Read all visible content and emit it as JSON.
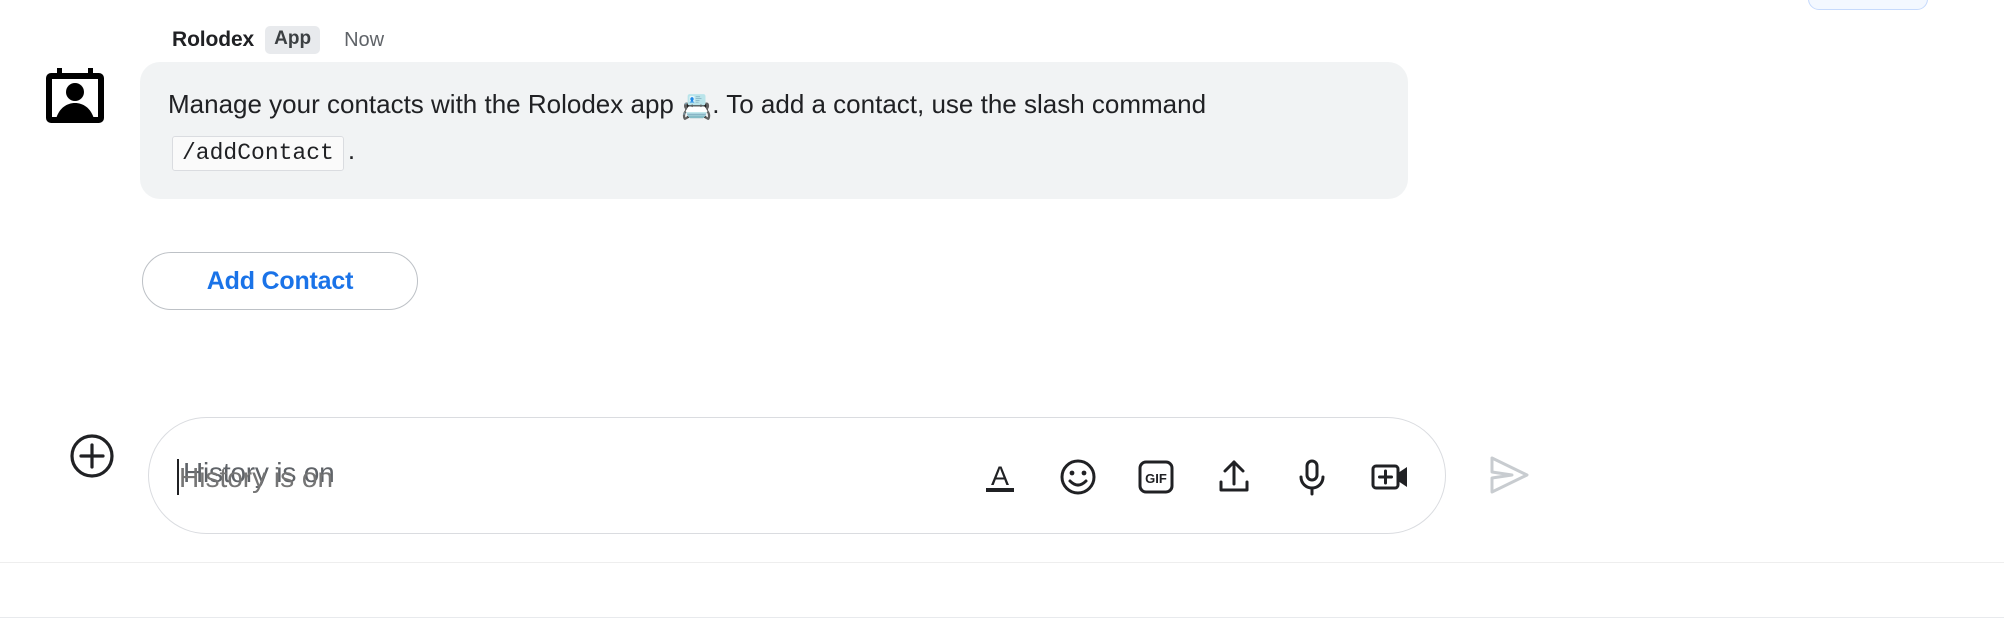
{
  "message": {
    "sender": "Rolodex",
    "badge": "App",
    "timestamp": "Now",
    "avatar_icon": "rolodex-card-person-icon",
    "body": {
      "text_before_emoji": "Manage your contacts with the Rolodex app ",
      "emoji": "📇",
      "text_after_emoji": ". To add a contact, use the slash command ",
      "code": "/addContact",
      "text_end": "."
    },
    "action_button": {
      "label": "Add Contact",
      "text_color": "#1a73e8",
      "border_color": "#bdc1c6"
    },
    "bubble_bg": "#f1f3f4"
  },
  "composer": {
    "add_button_icon": "plus-circle-icon",
    "input": {
      "value": "",
      "placeholder": "History is on"
    },
    "tools": [
      {
        "name": "format-text-icon",
        "label": "A"
      },
      {
        "name": "emoji-icon",
        "label": "☺"
      },
      {
        "name": "gif-icon",
        "label": "GIF"
      },
      {
        "name": "upload-icon",
        "label": "↑"
      },
      {
        "name": "microphone-icon",
        "label": "🎙"
      },
      {
        "name": "video-add-icon",
        "label": "⊞"
      }
    ],
    "send_icon": "send-arrow-icon",
    "send_enabled": false
  }
}
